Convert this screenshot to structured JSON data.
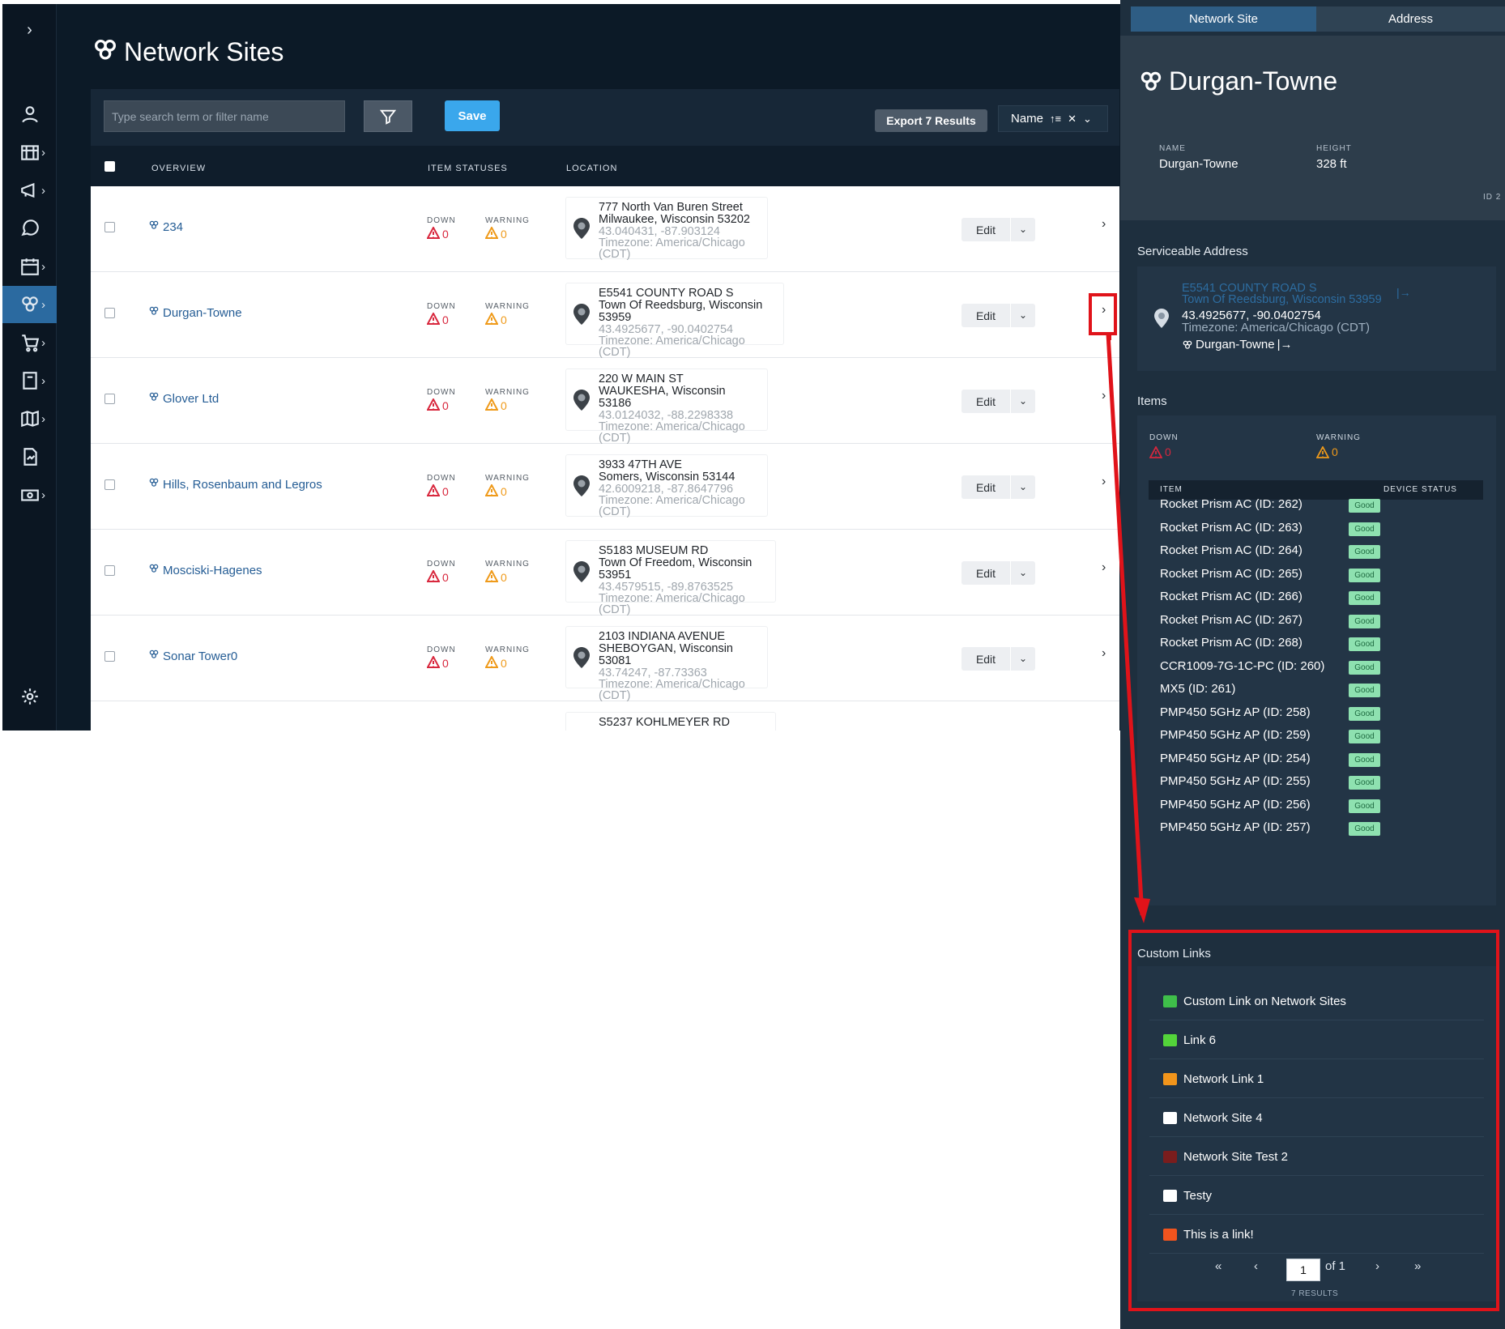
{
  "page": {
    "title": "Network Sites",
    "search_placeholder": "Type search term or filter name",
    "save_label": "Save",
    "export_label": "Export 7 Results",
    "sort_label": "Name",
    "sort_dir_icon": "sort-asc-icon",
    "columns": {
      "overview": "OVERVIEW",
      "statuses": "ITEM STATUSES",
      "location": "LOCATION"
    }
  },
  "rows": [
    {
      "name": "234",
      "down_label": "DOWN",
      "down": "0",
      "warn_label": "WARNING",
      "warn": "0",
      "addr1": "777 North Van Buren Street",
      "addr2": "Milwaukee, Wisconsin 53202",
      "coords": "43.040431, -87.903124",
      "tz": "Timezone: America/Chicago (CDT)"
    },
    {
      "name": "Durgan-Towne",
      "down_label": "DOWN",
      "down": "0",
      "warn_label": "WARNING",
      "warn": "0",
      "addr1": "E5541 COUNTY ROAD S",
      "addr2": "Town Of Reedsburg, Wisconsin 53959",
      "coords": "43.4925677, -90.0402754",
      "tz": "Timezone: America/Chicago (CDT)"
    },
    {
      "name": "Glover Ltd",
      "down_label": "DOWN",
      "down": "0",
      "warn_label": "WARNING",
      "warn": "0",
      "addr1": "220 W MAIN ST",
      "addr2": "WAUKESHA, Wisconsin 53186",
      "coords": "43.0124032, -88.2298338",
      "tz": "Timezone: America/Chicago (CDT)"
    },
    {
      "name": "Hills, Rosenbaum and Legros",
      "down_label": "DOWN",
      "down": "0",
      "warn_label": "WARNING",
      "warn": "0",
      "addr1": "3933 47TH AVE",
      "addr2": "Somers, Wisconsin 53144",
      "coords": "42.6009218, -87.8647796",
      "tz": "Timezone: America/Chicago (CDT)"
    },
    {
      "name": "Mosciski-Hagenes",
      "down_label": "DOWN",
      "down": "0",
      "warn_label": "WARNING",
      "warn": "0",
      "addr1": "S5183 MUSEUM RD",
      "addr2": "Town Of Freedom, Wisconsin 53951",
      "coords": "43.4579515, -89.8763525",
      "tz": "Timezone: America/Chicago (CDT)"
    },
    {
      "name": "Sonar Tower0",
      "down_label": "DOWN",
      "down": "0",
      "warn_label": "WARNING",
      "warn": "0",
      "addr1": "2103 INDIANA AVENUE",
      "addr2": "SHEBOYGAN, Wisconsin 53081",
      "coords": "43.74247, -87.73363",
      "tz": "Timezone: America/Chicago (CDT)"
    },
    {
      "addr1": "S5237 KOHLMEYER RD"
    }
  ],
  "row_edit_label": "Edit",
  "panel": {
    "tabs": [
      "Network Site",
      "Address"
    ],
    "title": "Durgan-Towne",
    "name_label": "NAME",
    "name_value": "Durgan-Towne",
    "height_label": "HEIGHT",
    "height_value": "328 ft",
    "id_label": "ID 2",
    "serviceable_title": "Serviceable Address",
    "serviceable": {
      "line1": "E5541 COUNTY ROAD S",
      "line2": "Town Of Reedsburg, Wisconsin 53959",
      "coords": "43.4925677, -90.0402754",
      "tz": "Timezone: America/Chicago (CDT)",
      "site": "Durgan-Towne"
    },
    "items_title": "Items",
    "down_label": "DOWN",
    "down_value": "0",
    "warn_label": "WARNING",
    "warn_value": "0",
    "item_col": "ITEM",
    "status_col": "DEVICE STATUS",
    "items": [
      {
        "name": "Rocket Prism AC (ID: 262)",
        "status": "Good"
      },
      {
        "name": "Rocket Prism AC (ID: 263)",
        "status": "Good"
      },
      {
        "name": "Rocket Prism AC (ID: 264)",
        "status": "Good"
      },
      {
        "name": "Rocket Prism AC (ID: 265)",
        "status": "Good"
      },
      {
        "name": "Rocket Prism AC (ID: 266)",
        "status": "Good"
      },
      {
        "name": "Rocket Prism AC (ID: 267)",
        "status": "Good"
      },
      {
        "name": "Rocket Prism AC (ID: 268)",
        "status": "Good"
      },
      {
        "name": "CCR1009-7G-1C-PC (ID: 260)",
        "status": "Good"
      },
      {
        "name": "MX5 (ID: 261)",
        "status": "Good"
      },
      {
        "name": "PMP450 5GHz AP (ID: 258)",
        "status": "Good"
      },
      {
        "name": "PMP450 5GHz AP (ID: 259)",
        "status": "Good"
      },
      {
        "name": "PMP450 5GHz AP (ID: 254)",
        "status": "Good"
      },
      {
        "name": "PMP450 5GHz AP (ID: 255)",
        "status": "Good"
      },
      {
        "name": "PMP450 5GHz AP (ID: 256)",
        "status": "Good"
      },
      {
        "name": "PMP450 5GHz AP (ID: 257)",
        "status": "Good"
      }
    ],
    "custom_links_title": "Custom Links",
    "custom_links": [
      {
        "label": "Custom Link on Network Sites",
        "icon": "money-icon",
        "color": "#3fbf4a"
      },
      {
        "label": "Link 6",
        "icon": "stack-icon",
        "color": "#53d43a"
      },
      {
        "label": "Network Link 1",
        "icon": "camera-icon",
        "color": "#f2951b"
      },
      {
        "label": "Network Site 4",
        "icon": "briefcase-icon",
        "color": "#ffffff"
      },
      {
        "label": "Network Site Test 2",
        "icon": "square-icon",
        "color": "#7a1d1d"
      },
      {
        "label": "Testy",
        "icon": "presentation-icon",
        "color": "#ffffff"
      },
      {
        "label": "This is a link!",
        "icon": "factory-icon",
        "color": "#f0541e"
      }
    ],
    "pagination": {
      "first": "«",
      "prev": "‹",
      "page": "1",
      "of": "of 1",
      "next": "›",
      "last": "»",
      "results": "7 RESULTS"
    }
  },
  "colors": {
    "accent": "#3aa7ec",
    "annotation": "#e0131a",
    "good": "#8ee1b0",
    "down": "#d8273d",
    "warning": "#ef9a1a"
  }
}
